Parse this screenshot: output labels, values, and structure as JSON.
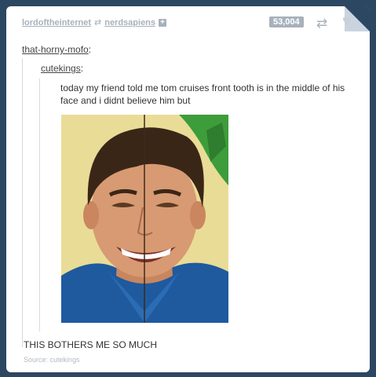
{
  "header": {
    "poster": "lordoftheinternet",
    "reblogged_from": "nerdsapiens",
    "reblog_glyph": "⇄",
    "follow_glyph": "+",
    "notes_count": "53,004",
    "reblog_icon_glyph": "⇄",
    "heart_icon_glyph": "♥"
  },
  "thread": {
    "user1": "that-horny-mofo",
    "user1_suffix": ":",
    "user2": "cutekings",
    "user2_suffix": ":",
    "text": "today my friend told me tom cruises front tooth is in the middle of his face and i didnt believe him but",
    "reply": "THIS BOTHERS ME SO MUCH"
  },
  "source": {
    "label": "Source:",
    "link": "cutekings"
  },
  "colors": {
    "dashboard_bg": "#2c4762",
    "post_bg": "#ffffff",
    "meta_gray": "#a7b1bb"
  },
  "icons": [
    "reblog-icon",
    "heart-icon",
    "follow-plus-icon"
  ]
}
